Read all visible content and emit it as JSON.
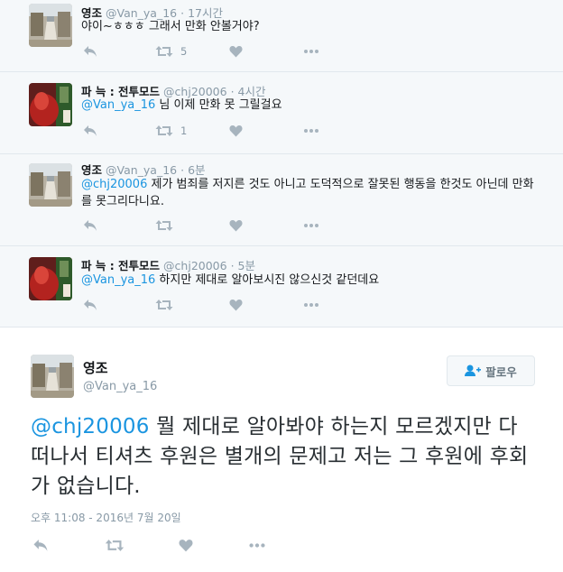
{
  "replies": [
    {
      "name": "영조",
      "handle": "@Van_ya_16",
      "time": "17시간",
      "mention": "",
      "text": "야이~ㅎㅎㅎ 그래서 만화 안볼거야?",
      "retweets": "5",
      "avatar": "street"
    },
    {
      "name": "파 늑 : 전투모드",
      "handle": "@chj20006",
      "time": "4시간",
      "mention": "@Van_ya_16",
      "text": " 님 이제 만화 못 그릴걸요",
      "retweets": "1",
      "avatar": "red"
    },
    {
      "name": "영조",
      "handle": "@Van_ya_16",
      "time": "6분",
      "mention": "@chj20006",
      "text": " 제가 범죄를 저지른 것도 아니고 도덕적으로 잘못된 행동을 한것도 아닌데 만화를 못그리다니요.",
      "retweets": "",
      "avatar": "street"
    },
    {
      "name": "파 늑 : 전투모드",
      "handle": "@chj20006",
      "time": "5분",
      "mention": "@Van_ya_16",
      "text": " 하지만 제대로 알아보시진 않으신것 같던데요",
      "retweets": "",
      "avatar": "red"
    }
  ],
  "main_tweet": {
    "name": "영조",
    "handle": "@Van_ya_16",
    "mention": "@chj20006",
    "text": " 뭘 제대로 알아봐야 하는지 모르겠지만 다 떠나서 티셔츠 후원은 별개의 문제고 저는 그 후원에 후회가 없습니다.",
    "follow_label": "팔로우",
    "date": "오후 11:08 - 2016년 7월 20일"
  },
  "colors": {
    "link": "#1b95e0",
    "muted": "#8899a6",
    "icon": "#a7b4be",
    "reply_bg": "#f5f8fa"
  }
}
